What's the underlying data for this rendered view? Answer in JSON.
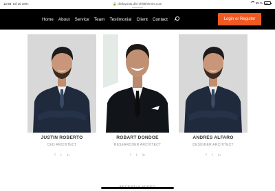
{
  "status_bar": {
    "time": "12:58",
    "date": "Cô 10 сент.",
    "url": "🔒 divilayouts.divi-childthemes.com",
    "battery": "65 %"
  },
  "nav": {
    "links": [
      "Home",
      "About",
      "Service",
      "Team",
      "Testimonial",
      "Client",
      "Contact"
    ],
    "login_label": "Login or Register",
    "accent_color": "#f05a22"
  },
  "team": [
    {
      "name": "JUSTIN ROBERTO",
      "role": "CEO ARCHITECT",
      "socials": [
        "f",
        "𝕥",
        "in"
      ]
    },
    {
      "name": "ROBART DONDOE",
      "role": "RESEARCHER ARCHITECT",
      "socials": [
        "f",
        "𝕥",
        "in"
      ]
    },
    {
      "name": "ANDRES ALFARO",
      "role": "DESIGNER ARCHITECT",
      "socials": [
        "f",
        "𝕥",
        "in"
      ]
    }
  ],
  "icons": [
    "search-icon",
    "wifi-icon",
    "battery-icon",
    "facebook-icon",
    "twitter-icon",
    "linkedin-icon"
  ],
  "footer_heading": "RECENTLY ADDED"
}
